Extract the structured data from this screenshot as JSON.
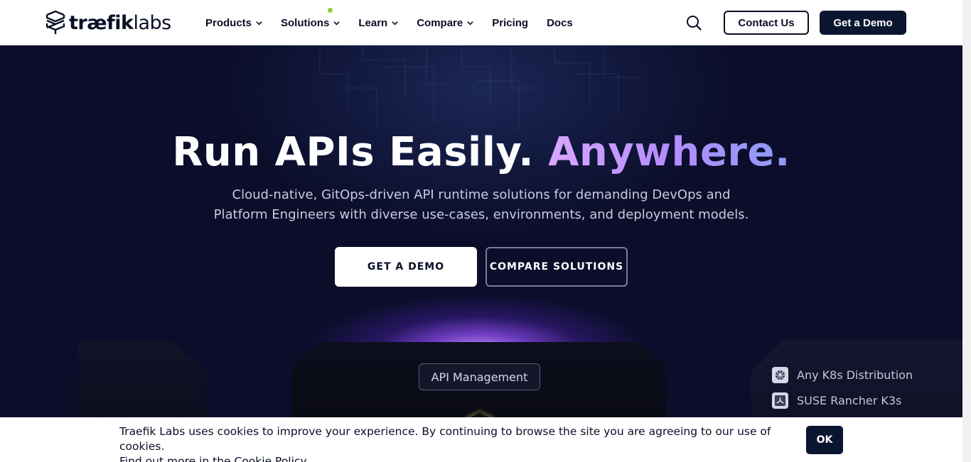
{
  "header": {
    "logo_bold": "træfik",
    "logo_thin": "labs",
    "nav": [
      {
        "label": "Products"
      },
      {
        "label": "Solutions"
      },
      {
        "label": "Learn"
      },
      {
        "label": "Compare"
      },
      {
        "label": "Pricing"
      },
      {
        "label": "Docs"
      }
    ],
    "contact_label": "Contact Us",
    "demo_label": "Get a Demo"
  },
  "hero": {
    "title_main": "Run APIs Easily. ",
    "title_accent": "Anywhere.",
    "subtitle_line1": "Cloud-native, GitOps-driven API runtime solutions for demanding DevOps and",
    "subtitle_line2": "Platform Engineers with diverse use-cases, environments, and deployment models.",
    "cta_primary": "GET A DEMO",
    "cta_secondary": "COMPARE SOLUTIONS",
    "badge": "API Management",
    "distributions": [
      {
        "label": "Any K8s Distribution",
        "icon": "kubernetes-icon"
      },
      {
        "label": "SUSE Rancher K3s",
        "icon": "rancher-icon"
      }
    ]
  },
  "cookie": {
    "line1": "Traefik Labs uses cookies to improve your experience. By continuing to browse the site you are agreeing to our use of cookies.",
    "line2": "Find out more in the Cookie Policy.",
    "ok_label": "OK"
  },
  "colors": {
    "navy": "#0a1530",
    "hero_bg": "#0b0d2a",
    "accent_start": "#d8a7ff",
    "accent_end": "#8c9cf5",
    "status_dot": "#8ecf3d"
  }
}
